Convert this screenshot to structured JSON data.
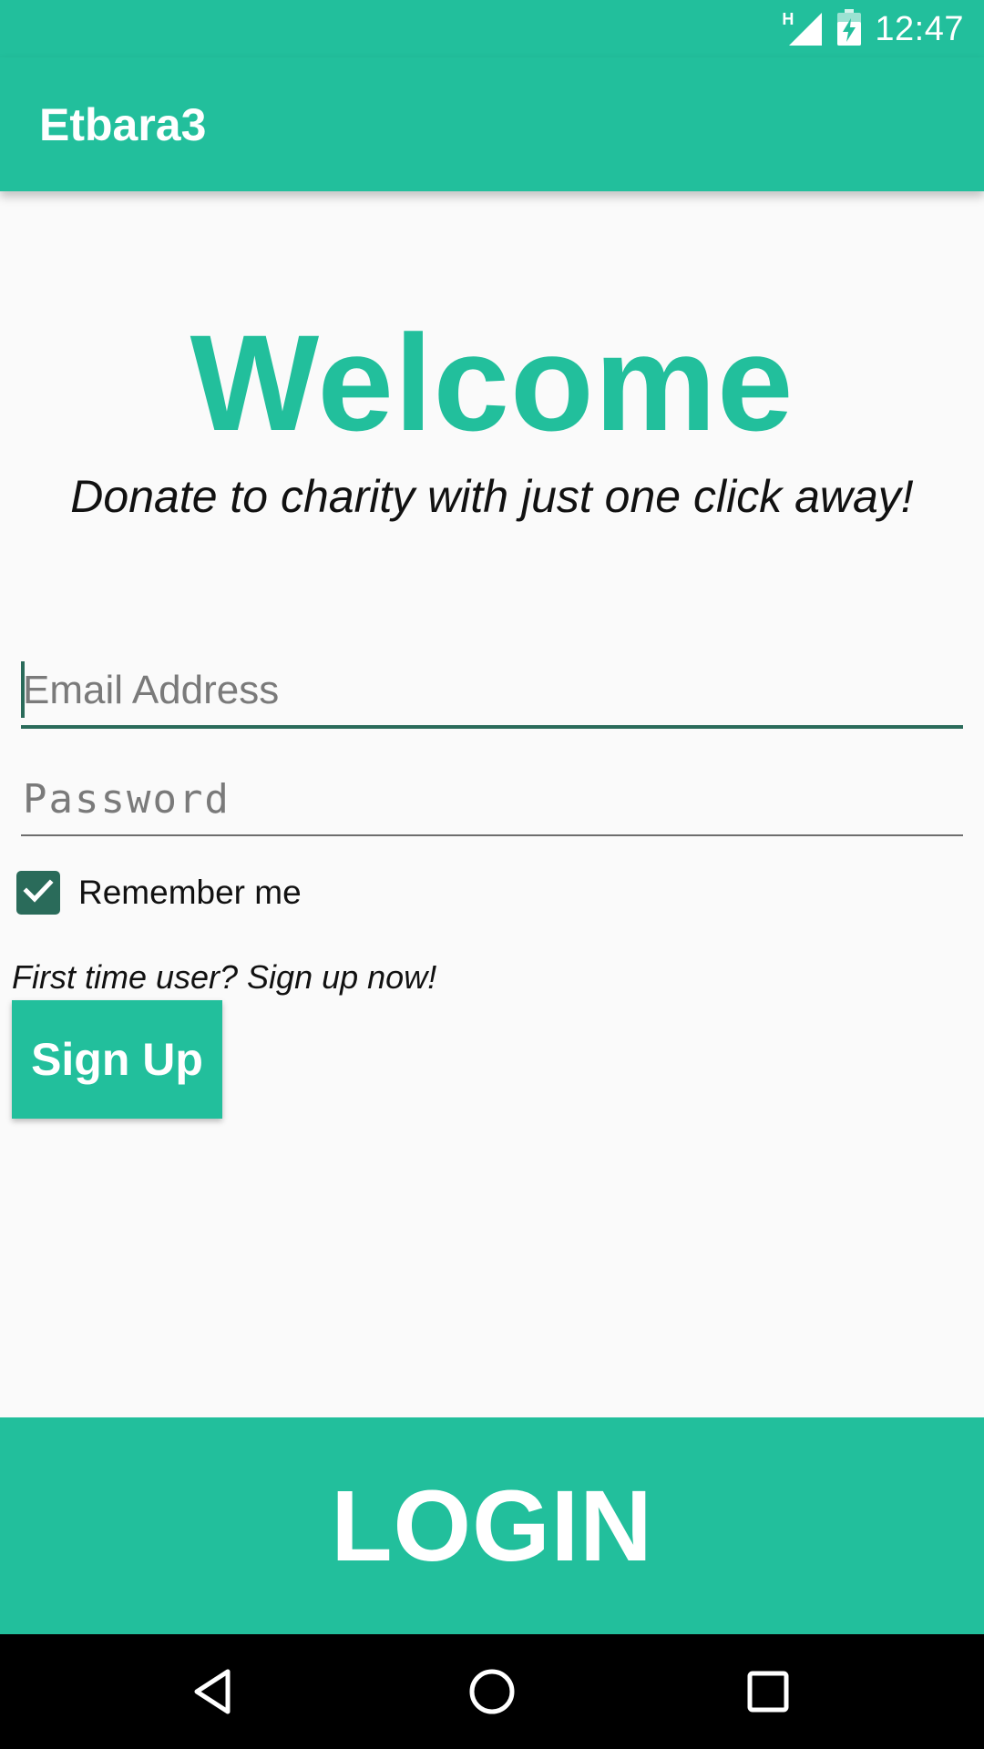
{
  "status_bar": {
    "network_type": "H",
    "time": "12:47"
  },
  "app_bar": {
    "title": "Etbara3"
  },
  "welcome": {
    "title": "Welcome",
    "tagline": "Donate to charity with just one click away!"
  },
  "form": {
    "email_placeholder": "Email Address",
    "password_placeholder": "Password",
    "remember_label": "Remember me",
    "remember_checked": true
  },
  "signup": {
    "prompt": "First time user? Sign up now!",
    "button_label": "Sign Up"
  },
  "login": {
    "button_label": "LOGIN"
  },
  "theme": {
    "accent": "#22bf9c",
    "dark_accent": "#2a6b5a",
    "background": "#fafafa"
  },
  "icons": [
    "signal-icon",
    "battery-charging-icon",
    "check-icon",
    "back-icon",
    "home-icon",
    "recent-apps-icon"
  ]
}
